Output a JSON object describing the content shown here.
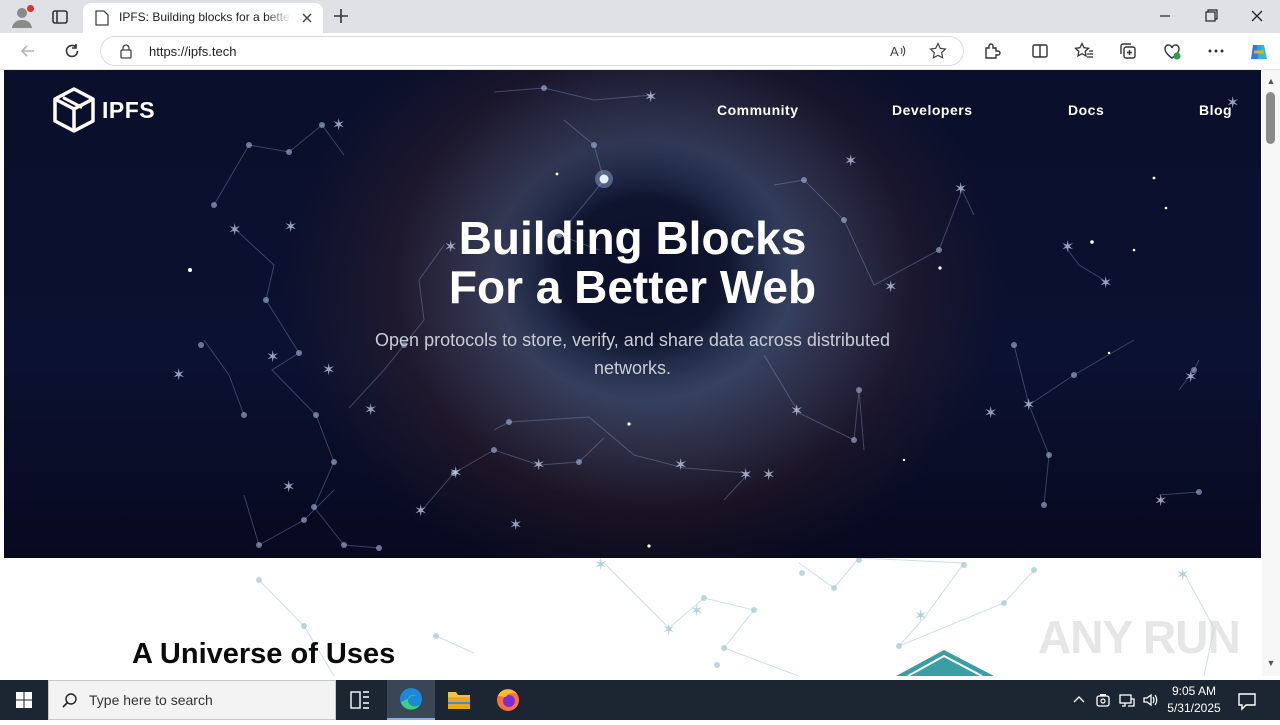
{
  "browser": {
    "tab_title": "IPFS: Building blocks for a better web",
    "url": "https://ipfs.tech"
  },
  "site": {
    "logo_text": "IPFS",
    "nav": [
      "Community",
      "Developers",
      "Docs",
      "Blog"
    ],
    "hero_title_line1": "Building Blocks",
    "hero_title_line2": "For a Better Web",
    "hero_subtitle": "Open protocols to store, verify, and share data across distributed networks.",
    "section_title": "A Universe of Uses"
  },
  "watermark": "ANY RUN",
  "taskbar": {
    "search_placeholder": "Type here to search",
    "time": "9:05 AM",
    "date": "5/31/2025"
  },
  "colors": {
    "hero_bg": "#0a0f2b",
    "accent_teal": "#3a9ea5",
    "taskbar_bg": "#1c2633"
  }
}
